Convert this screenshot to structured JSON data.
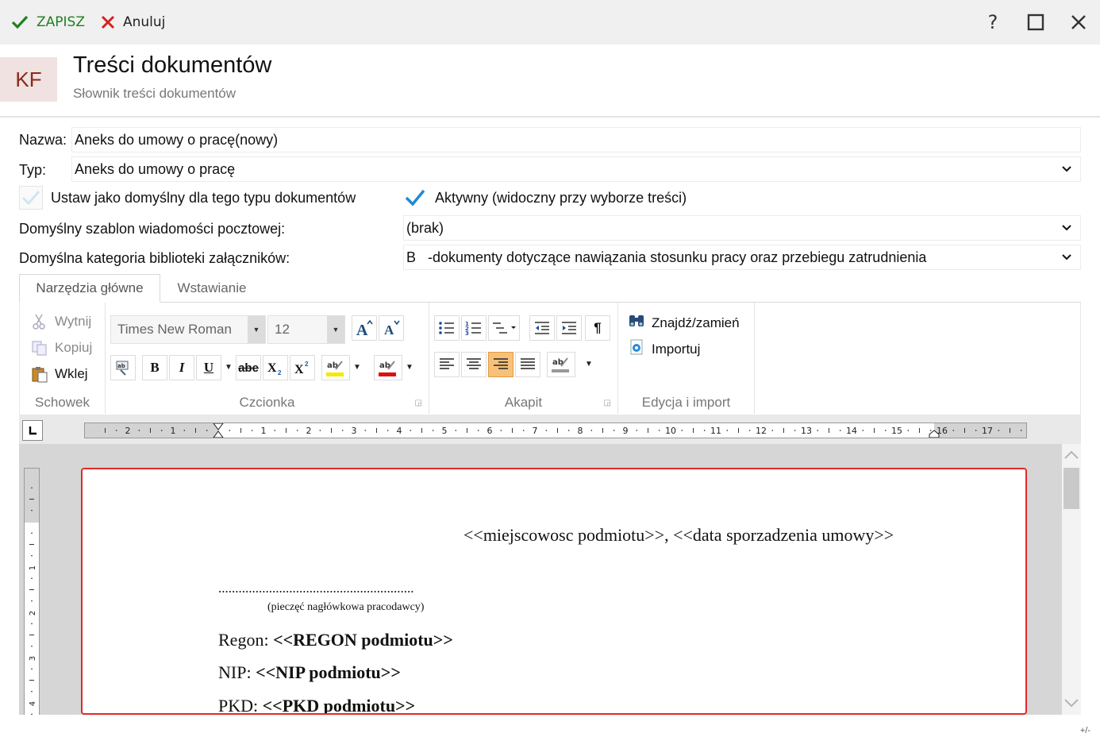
{
  "toolbar": {
    "save_label": "ZAPISZ",
    "cancel_label": "Anuluj",
    "help_label": "?"
  },
  "header": {
    "badge": "KF",
    "title": "Treści dokumentów",
    "subtitle": "Słownik treści dokumentów"
  },
  "form": {
    "name_label": "Nazwa:",
    "name_value": "Aneks do umowy o pracę(nowy)",
    "type_label": "Typ:",
    "type_value": "Aneks do umowy o pracę",
    "default_checkbox_label": "Ustaw jako domyślny dla tego typu dokumentów",
    "default_checked": false,
    "active_checkbox_label": "Aktywny (widoczny przy wyborze treści)",
    "active_checked": true,
    "mail_template_label": "Domyślny szablon wiadomości pocztowej:",
    "mail_template_value": "(brak)",
    "attachment_category_label": "Domyślna kategoria biblioteki załączników:",
    "attachment_category_value": "B   -dokumenty dotyczące nawiązania stosunku pracy oraz przebiegu zatrudnienia"
  },
  "ribbon": {
    "tabs": [
      "Narzędzia główne",
      "Wstawianie"
    ],
    "active_tab": "Narzędzia główne",
    "clipboard": {
      "cut": "Wytnij",
      "copy": "Kopiuj",
      "paste": "Wklej",
      "group": "Schowek"
    },
    "font": {
      "family": "Times New Roman",
      "size": "12",
      "group": "Czcionka",
      "bold": "B",
      "italic": "I",
      "underline": "U",
      "strike": "abe"
    },
    "paragraph": {
      "group": "Akapit",
      "pilcrow": "¶"
    },
    "edit": {
      "find": "Znajdź/zamień",
      "import": "Importuj",
      "group": "Edycja i import"
    }
  },
  "ruler": {
    "labels": [
      "2",
      "1",
      "1",
      "2",
      "3",
      "4",
      "5",
      "6",
      "7",
      "8",
      "9",
      "10",
      "11",
      "12",
      "13",
      "14",
      "15",
      "16",
      "17"
    ],
    "vertical_labels": [
      "1",
      "2",
      "3",
      "4"
    ]
  },
  "document": {
    "place_date": "<<miejscowosc podmiotu>>, <<data sporzadzenia umowy>>",
    "dots": "..........................................................",
    "stamp_note": "(pieczęć nagłówkowa pracodawcy)",
    "regon_label": "Regon: ",
    "regon_value": "<<REGON podmiotu>>",
    "nip_label": "NIP: ",
    "nip_value": "<<NIP podmiotu>>",
    "pkd_label": "PKD: ",
    "pkd_value": "<<PKD podmiotu>>"
  },
  "status": {
    "zoom_toggle": "+/-"
  },
  "colors": {
    "accent_green": "#208020",
    "cancel_red": "#d82020",
    "selection_orange": "#f8c17a",
    "page_border": "#e02a2a"
  }
}
